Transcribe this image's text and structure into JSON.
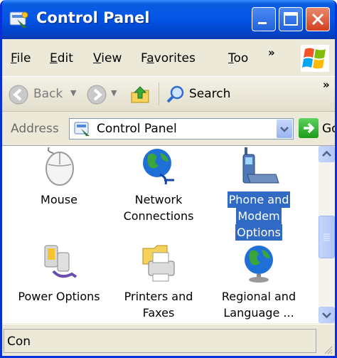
{
  "window": {
    "title": "Control Panel"
  },
  "menu": [
    {
      "label": "File",
      "accel": "F",
      "rest": "ile"
    },
    {
      "label": "Edit",
      "accel": "E",
      "rest": "dit"
    },
    {
      "label": "View",
      "accel": "V",
      "rest": "iew"
    },
    {
      "label": "Favorites",
      "pre": "F",
      "accel": "a",
      "rest": "vorites"
    },
    {
      "label": "Too",
      "accel": "T",
      "rest": "oo"
    }
  ],
  "menu_more": "»",
  "toolbar": {
    "back_label": "Back",
    "search_label": "Search",
    "more": "»"
  },
  "address": {
    "label": "Address",
    "value": "Control Panel",
    "go_label": "Go"
  },
  "items": [
    {
      "label_lines": [
        "Mouse"
      ],
      "icon": "mouse-icon",
      "selected": false
    },
    {
      "label_lines": [
        "Network",
        "Connections"
      ],
      "icon": "network-connections-icon",
      "selected": false
    },
    {
      "label_lines": [
        "Phone and",
        "Modem",
        "Options"
      ],
      "icon": "phone-modem-icon",
      "selected": true
    },
    {
      "label_lines": [
        "Power Options"
      ],
      "icon": "power-options-icon",
      "selected": false
    },
    {
      "label_lines": [
        "Printers and",
        "Faxes"
      ],
      "icon": "printers-faxes-icon",
      "selected": false
    },
    {
      "label_lines": [
        "Regional and",
        "Language ..."
      ],
      "icon": "regional-language-icon",
      "selected": false
    }
  ],
  "status": {
    "text": "Con"
  },
  "colors": {
    "title_bar": "#0355e8",
    "selection": "#316ac5",
    "chrome": "#ece9d8"
  }
}
